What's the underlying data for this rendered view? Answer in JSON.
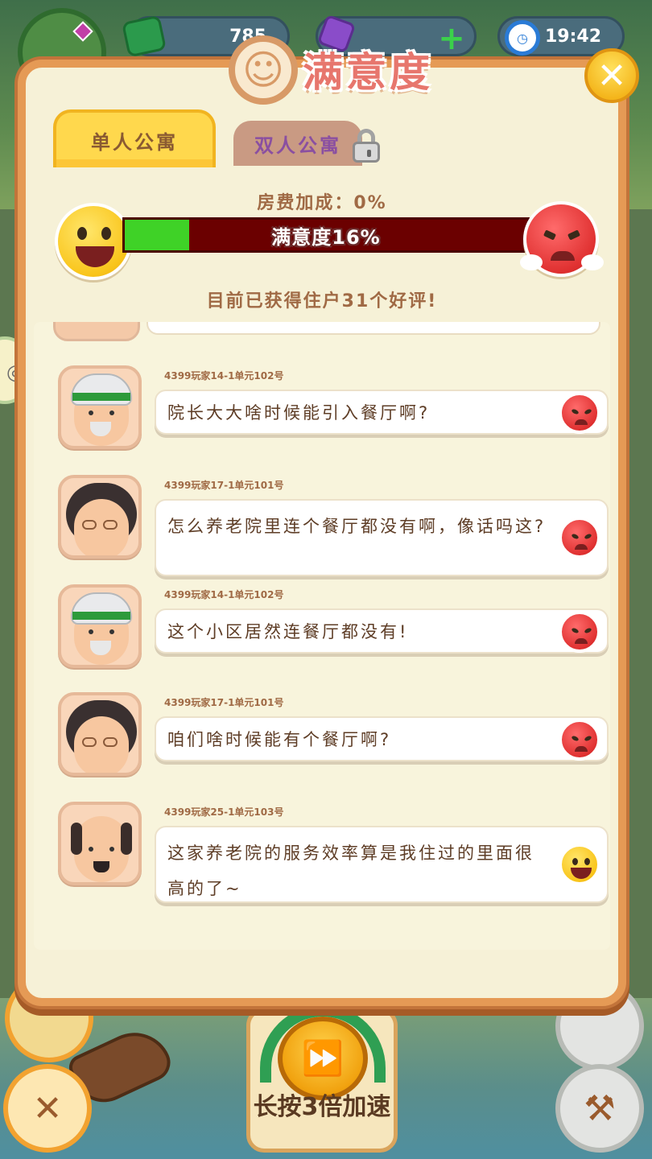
{
  "hud": {
    "money": "785",
    "time": "19:42"
  },
  "modal": {
    "title": "满意度",
    "tabs": [
      {
        "label": "单人公寓",
        "active": true,
        "locked": false
      },
      {
        "label": "双人公寓",
        "active": false,
        "locked": true
      }
    ],
    "rent_bonus": "房费加成：0%",
    "satisfaction": {
      "label": "满意度16%",
      "percent": 16
    },
    "review_count_text": "目前已获得住户31个好评!"
  },
  "messages": [
    {
      "sender": "4399玩家14-1单元102号",
      "text": "院长大大啥时候能引入餐厅啊?",
      "mood": "angry",
      "avatar": "white-hair-grandpa"
    },
    {
      "sender": "4399玩家17-1单元101号",
      "text": "怎么养老院里连个餐厅都没有啊，像话吗这?",
      "mood": "angry",
      "avatar": "curly-hair-grandma"
    },
    {
      "sender": "4399玩家14-1单元102号",
      "text": "这个小区居然连餐厅都没有!",
      "mood": "angry",
      "avatar": "white-hair-grandpa"
    },
    {
      "sender": "4399玩家17-1单元101号",
      "text": "咱们啥时候能有个餐厅啊?",
      "mood": "angry",
      "avatar": "curly-hair-grandma"
    },
    {
      "sender": "4399玩家25-1单元103号",
      "text": "这家养老院的服务效率算是我住过的里面很高的了~",
      "mood": "happy",
      "avatar": "bald-grandpa"
    }
  ],
  "speed_button": {
    "label": "长按3倍加速"
  },
  "colors": {
    "modal_bg": "#f6f1d7",
    "modal_border": "#e59a55",
    "title_red": "#e7766d",
    "bar_fill_green": "#3fd227",
    "bar_empty": "#6b0000",
    "text_brown": "#5e3d26"
  },
  "icons": [
    "level-badge-icon",
    "money-icon",
    "gem-icon",
    "plus-icon",
    "clock-icon",
    "close-icon",
    "lock-icon",
    "happy-face-icon",
    "angry-face-icon",
    "fast-forward-icon",
    "tools-icon",
    "hammer-icon",
    "gamepad-icon"
  ]
}
